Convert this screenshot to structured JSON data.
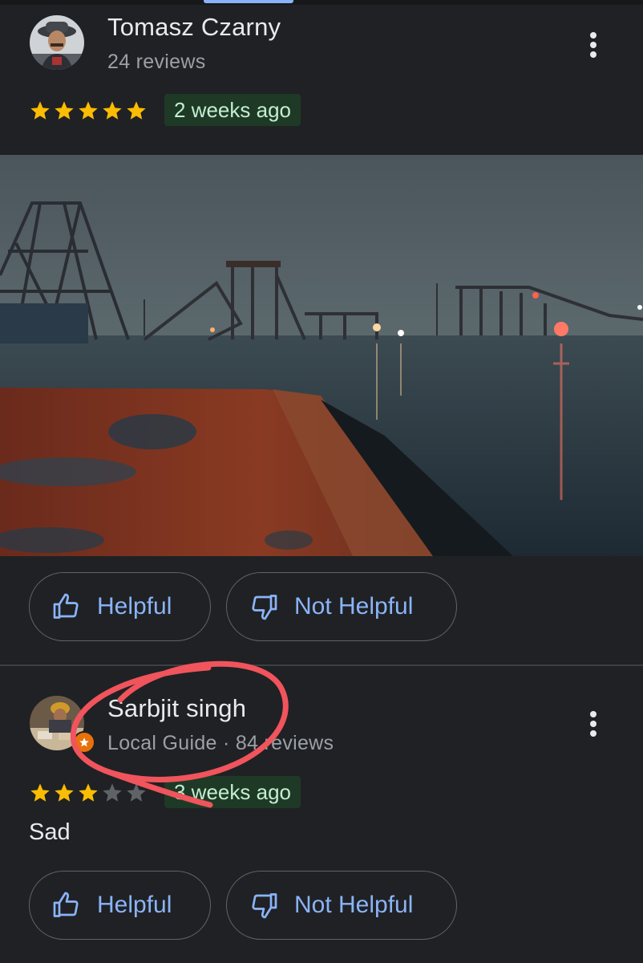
{
  "reviews": [
    {
      "author": "Tomasz Czarny",
      "meta": "24 reviews",
      "rating": 5,
      "date": "2 weeks ago",
      "helpful_label": "Helpful",
      "not_helpful_label": "Not Helpful",
      "avatar_icon": "user-avatar-photo",
      "photo_icon": "collapsed-bridge-photo"
    },
    {
      "author": "Sarbjit singh",
      "meta": "Local Guide · 84 reviews",
      "rating": 3,
      "date": "3 weeks ago",
      "text": "Sad",
      "helpful_label": "Helpful",
      "not_helpful_label": "Not Helpful",
      "avatar_icon": "user-avatar-photo",
      "badge_icon": "local-guide-star-icon"
    }
  ],
  "colors": {
    "background": "#202124",
    "accent": "#8ab4f8",
    "star": "#fbbc04",
    "date_badge_bg": "#1e3a26",
    "annotation": "#f0545c"
  }
}
